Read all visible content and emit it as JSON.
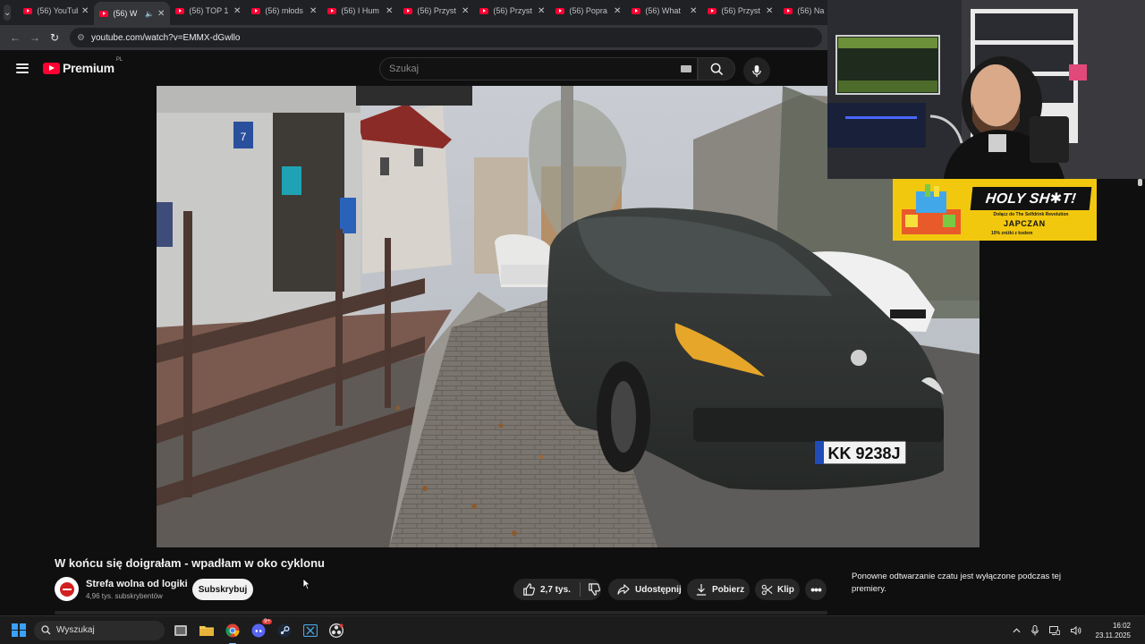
{
  "browser": {
    "tabs": [
      {
        "title": "(56) YouTube",
        "active": false
      },
      {
        "title": "(56) W",
        "active": true
      },
      {
        "title": "(56) TOP 1",
        "active": false
      },
      {
        "title": "(56) młods",
        "active": false
      },
      {
        "title": "(56) I Hum",
        "active": false
      },
      {
        "title": "(56) Przyst",
        "active": false
      },
      {
        "title": "(56) Przyst",
        "active": false
      },
      {
        "title": "(56) Popra",
        "active": false
      },
      {
        "title": "(56) What",
        "active": false
      },
      {
        "title": "(56) Przyst",
        "active": false
      },
      {
        "title": "(56) Na",
        "active": false
      }
    ],
    "url": "youtube.com/watch?v=EMMX-dGwllo"
  },
  "youtube": {
    "logo_text": "Premium",
    "country_code": "PL",
    "search_placeholder": "Szukaj"
  },
  "video": {
    "title": "W końcu się doigrałam - wpadłam w oko cyklonu",
    "plate": "KK 9238J",
    "house_number": "7",
    "channel": {
      "name": "Strefa wolna od logiki",
      "subscribers": "4,96 tys. subskrybentów"
    },
    "subscribe_label": "Subskrybuj",
    "actions": {
      "likes": "2,7 tys.",
      "share": "Udostępnij",
      "download": "Pobierz",
      "clip": "Klip"
    }
  },
  "chat_notice": "Ponowne odtwarzanie czatu jest wyłączone podczas tej premiery.",
  "overlay_promo": {
    "headline": "HOLY SH✱T!",
    "line1": "Dołącz do The Selfdrink Revolution",
    "brand": "JAPCZAN",
    "line2": "10% zniżki z kodem"
  },
  "taskbar": {
    "search_label": "Wyszukaj",
    "discord_badge": "9+",
    "time": "16:02",
    "date": "23.11.2025"
  },
  "colors": {
    "youtube_red": "#ff0033",
    "background": "#0f0f0f",
    "promo_yellow": "#f2c80f",
    "windows_blue": "#3aa0ff"
  }
}
